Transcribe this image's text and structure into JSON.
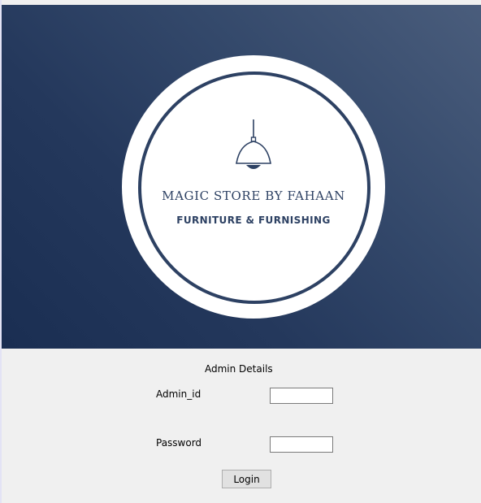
{
  "banner": {
    "brand_title": "MAGIC STORE BY FAHAAN",
    "brand_subtitle": "FURNITURE & FURNISHING",
    "logo_icon": "pendant-lamp-icon",
    "colors": {
      "navy": "#2d4163",
      "gradient_dark": "#1a2e52",
      "gradient_light": "#4a5d7c"
    }
  },
  "form": {
    "heading": "Admin Details",
    "admin_id_label": "Admin_id",
    "admin_id_value": "",
    "password_label": "Password",
    "password_value": "",
    "login_label": "Login"
  }
}
